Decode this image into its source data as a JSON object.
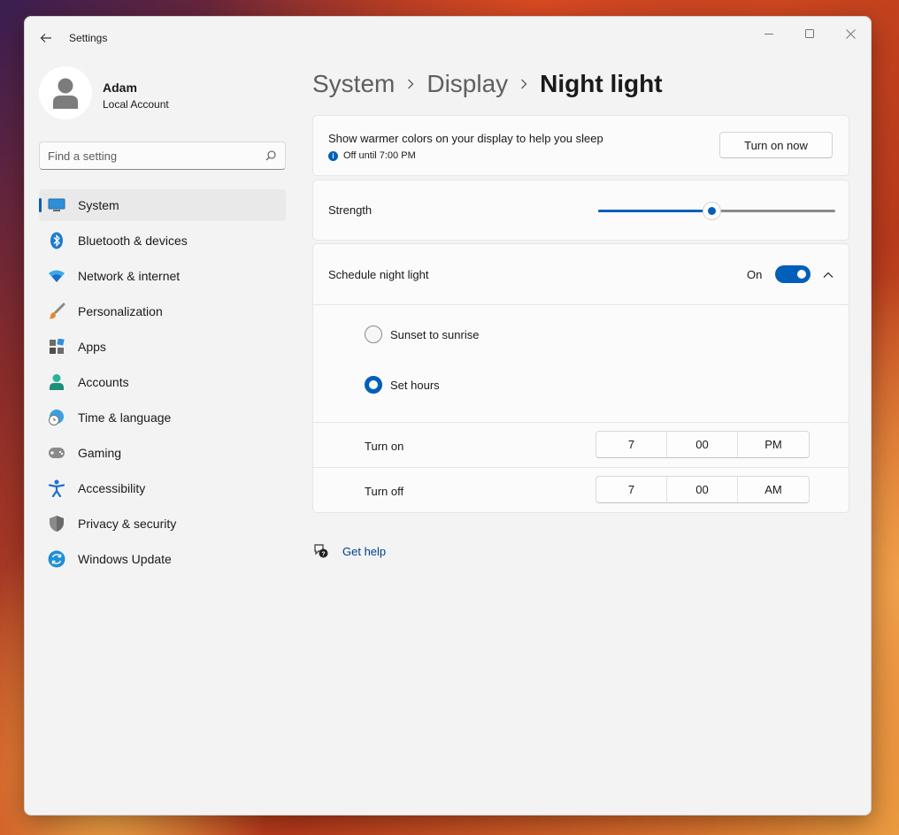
{
  "app": {
    "title": "Settings"
  },
  "profile": {
    "name": "Adam",
    "account_type": "Local Account"
  },
  "search": {
    "placeholder": "Find a setting",
    "icon": "search-icon"
  },
  "sidebar": {
    "items": [
      {
        "label": "System",
        "icon": "monitor-icon",
        "active": true
      },
      {
        "label": "Bluetooth & devices",
        "icon": "bluetooth-icon"
      },
      {
        "label": "Network & internet",
        "icon": "wifi-icon"
      },
      {
        "label": "Personalization",
        "icon": "brush-icon"
      },
      {
        "label": "Apps",
        "icon": "apps-icon"
      },
      {
        "label": "Accounts",
        "icon": "person-icon"
      },
      {
        "label": "Time & language",
        "icon": "globe-clock-icon"
      },
      {
        "label": "Gaming",
        "icon": "gamepad-icon"
      },
      {
        "label": "Accessibility",
        "icon": "accessibility-icon"
      },
      {
        "label": "Privacy & security",
        "icon": "shield-icon"
      },
      {
        "label": "Windows Update",
        "icon": "update-icon"
      }
    ]
  },
  "breadcrumb": {
    "items": [
      "System",
      "Display",
      "Night light"
    ]
  },
  "night_light": {
    "description": "Show warmer colors on your display to help you sleep",
    "status": "Off until 7:00 PM",
    "turn_on_button": "Turn on now"
  },
  "strength": {
    "label": "Strength",
    "value_fraction": 0.48
  },
  "schedule": {
    "label": "Schedule night light",
    "toggle_state": "On",
    "options": [
      {
        "label": "Sunset to sunrise",
        "selected": false
      },
      {
        "label": "Set hours",
        "selected": true
      }
    ],
    "turn_on": {
      "label": "Turn on",
      "hour": "7",
      "minute": "00",
      "period": "PM"
    },
    "turn_off": {
      "label": "Turn off",
      "hour": "7",
      "minute": "00",
      "period": "AM"
    }
  },
  "help": {
    "label": "Get help"
  },
  "colors": {
    "accent": "#005fb8",
    "window_bg": "#f3f3f3",
    "card_bg": "#fbfbfb"
  }
}
